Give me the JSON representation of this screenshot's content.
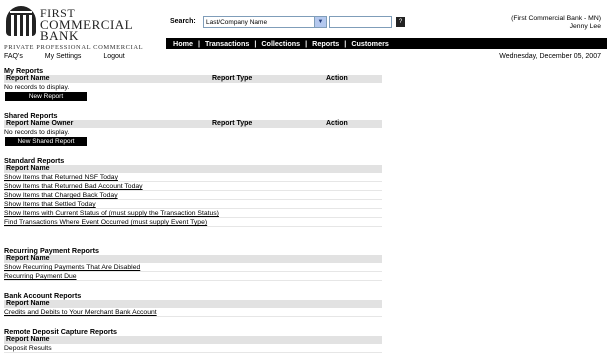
{
  "logo": {
    "line1": "First",
    "line2": "Commercial",
    "line3": "Bank",
    "tagline": "Private  Professional  Commercial"
  },
  "search": {
    "label": "Search:",
    "selected": "Last/Company Name",
    "input_value": "",
    "go_label": "?"
  },
  "user": {
    "bank": "(First Commercial Bank - MN)",
    "name": "Jenny Lee"
  },
  "nav": {
    "items": [
      "Home",
      "Transactions",
      "Collections",
      "Reports",
      "Customers"
    ],
    "separator": "|"
  },
  "subnav": {
    "faq": "FAQ's",
    "settings": "My Settings",
    "logout": "Logout"
  },
  "date": "Wednesday, December 05, 2007",
  "my_reports": {
    "title": "My Reports",
    "columns": [
      "Report Name",
      "Report Type",
      "Action"
    ],
    "empty": "No records to display.",
    "button": "New Report"
  },
  "shared_reports": {
    "title": "Shared Reports",
    "columns": [
      "Report Name Owner",
      "Report Type",
      "Action"
    ],
    "empty": "No records to display.",
    "button": "New Shared Report"
  },
  "standard_reports": {
    "title": "Standard Reports",
    "column": "Report Name",
    "items": [
      "Show Items that Returned NSF Today",
      "Show Items that Returned Bad Account Today",
      "Show Items that Charged Back Today",
      "Show Items that Settled Today",
      "Show Items with Current Status of (must supply the Transaction Status)",
      "Find Transactions Where Event Occurred (must supply Event Type)"
    ]
  },
  "recurring_reports": {
    "title": "Recurring Payment Reports",
    "column": "Report Name",
    "items": [
      "Show Recurring Payments That Are Disabled",
      "Recurring Payment Due"
    ]
  },
  "bank_reports": {
    "title": "Bank Account Reports",
    "column": "Report Name",
    "items": [
      "Credits and Debits to Your Merchant Bank Account"
    ]
  },
  "rdc_reports": {
    "title": "Remote Deposit Capture Reports",
    "column": "Report Name",
    "items": [
      "Deposit Results"
    ]
  }
}
